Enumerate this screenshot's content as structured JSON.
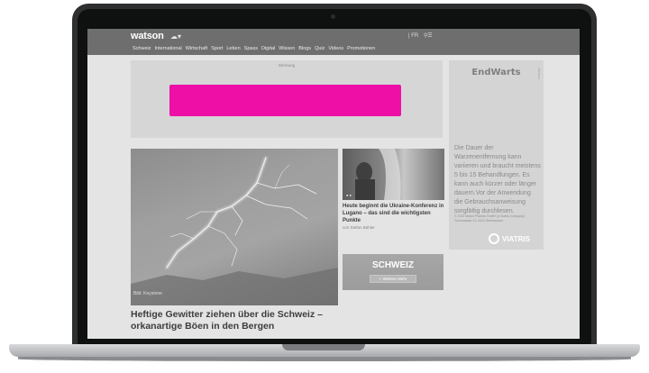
{
  "header": {
    "logo": "watson",
    "weather_icon": "cloud-icon",
    "right_icons": "| FR",
    "search_icon": "search-menu-icon"
  },
  "nav": {
    "items": [
      "Schweiz",
      "International",
      "Wirtschaft",
      "Sport",
      "Leben",
      "Spass",
      "Digital",
      "Wissen",
      "Blogs",
      "Quiz",
      "Videos",
      "Promotionen"
    ]
  },
  "ad": {
    "label": "Werbung",
    "banner_color": "#ee10a6"
  },
  "side_ad": {
    "brand": "EndWarts",
    "side_text": "Pflichttext",
    "body": "Die Dauer der Warzenentfernung kann variieren und braucht meistens 5 bis 15 Behandlungen. Es kann auch kürzer oder länger dauern.Vor der Anwendung die Gebrauchsanweisung sorgfältig durchlesen.",
    "fine_print": "© 2022 Mylan Pharma GmbH (a Viatris Company), Turmstrasse 24, 6312 Steinhausen",
    "logo": "VIATRIS"
  },
  "lead": {
    "image_credit": "Bild: Keystone",
    "title": "Heftige Gewitter ziehen über die Schweiz – orkanartige Böen in den Bergen"
  },
  "teaser1": {
    "dots": "● ●",
    "title": "Heute beginnt die Ukraine-Konferenz in Lugano – das sind die wichtigsten Punkte",
    "author": "von Stefan Bühler"
  },
  "teaser2": {
    "title": "SCHWEIZ",
    "tag": "+ Weitere Mehr"
  }
}
